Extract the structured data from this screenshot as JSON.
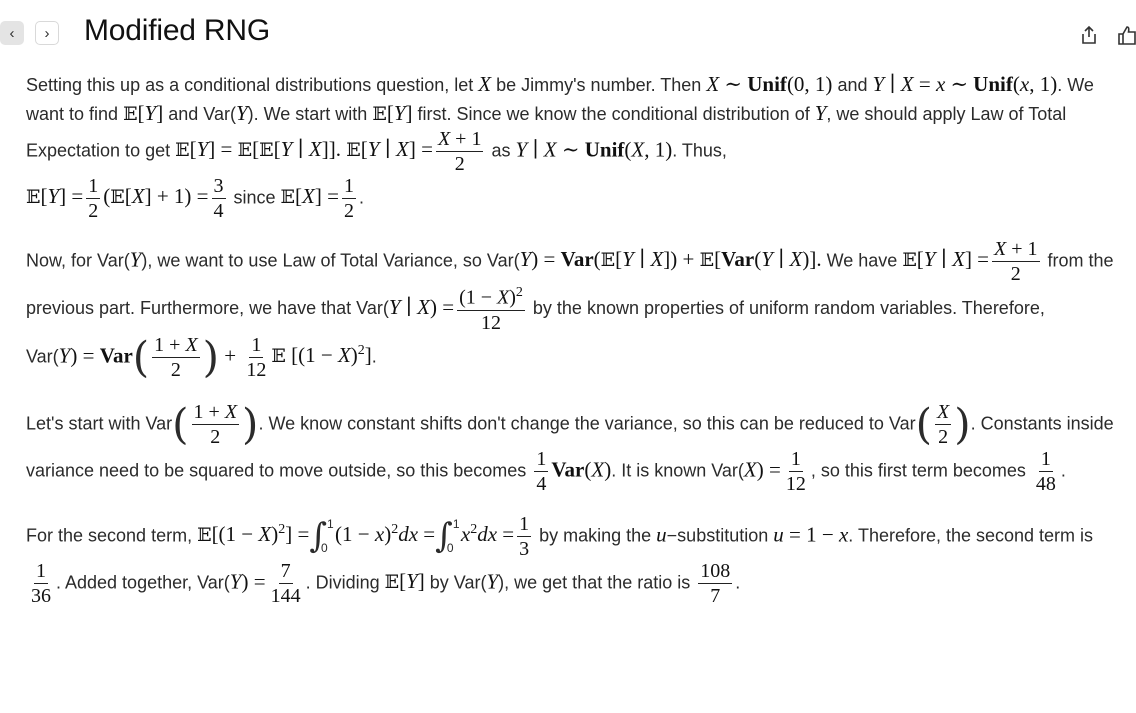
{
  "header": {
    "back_glyph": "‹",
    "forward_glyph": "›",
    "title": "Modified RNG",
    "icons": [
      "share-icon",
      "thumbs-up-icon"
    ]
  },
  "content": {
    "p1": {
      "t1": "Setting this up as a conditional distributions question, let ",
      "t2": " be Jimmy's number. Then ",
      "t3": " and ",
      "t4": ". We want to find ",
      "t5": " and Var(",
      "t6": "). We start with ",
      "t7": " first. Since we know the conditional distribution of ",
      "t8": ", we should apply Law of Total Expectation to get ",
      "t9": " as ",
      "t10": ". Thus, ",
      "t11": " since "
    },
    "p2": {
      "t1": "Now, for Var(",
      "t2": "), we want to use Law of Total Variance, so Var(",
      "t3": "We have ",
      "t4": " from the previous part. Furthermore, we have that Var(",
      "t5": " by the known properties of uniform random variables. Therefore, Var(",
      "t6": "."
    },
    "p3": {
      "t1": "Let's start with Var",
      "t2": ". We know constant shifts don't change the variance, so this can be reduced to Var",
      "t3": ". Constants inside variance need to be squared to move outside, so this becomes ",
      "t4": ". It is known Var(",
      "t5": ", so this first term becomes ",
      "t6": "."
    },
    "p4": {
      "t1": "For the second term, ",
      "t2": " by making the ",
      "t3": "−substitution ",
      "t4": ". Therefore, the second term is ",
      "t5": ". Added together, Var(",
      "t6": ". Dividing ",
      "t7": " by Var(",
      "t8": "), we get that the ratio is ",
      "t9": "."
    }
  }
}
